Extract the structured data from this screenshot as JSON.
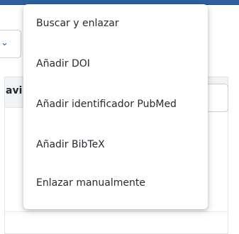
{
  "colors": {
    "accent": "#2f5f9e",
    "menu_text": "#262b32",
    "panel_header_bg": "#f1f3f5"
  },
  "background": {
    "panel_header_label": "avi",
    "select_chevron_icon": "chevron-down-icon"
  },
  "menu": {
    "items": [
      {
        "label": "Buscar y enlazar"
      },
      {
        "label": "Añadir DOI"
      },
      {
        "label": "Añadir identificador PubMed"
      },
      {
        "label": "Añadir BibTeX"
      },
      {
        "label": "Enlazar manualmente"
      }
    ]
  }
}
